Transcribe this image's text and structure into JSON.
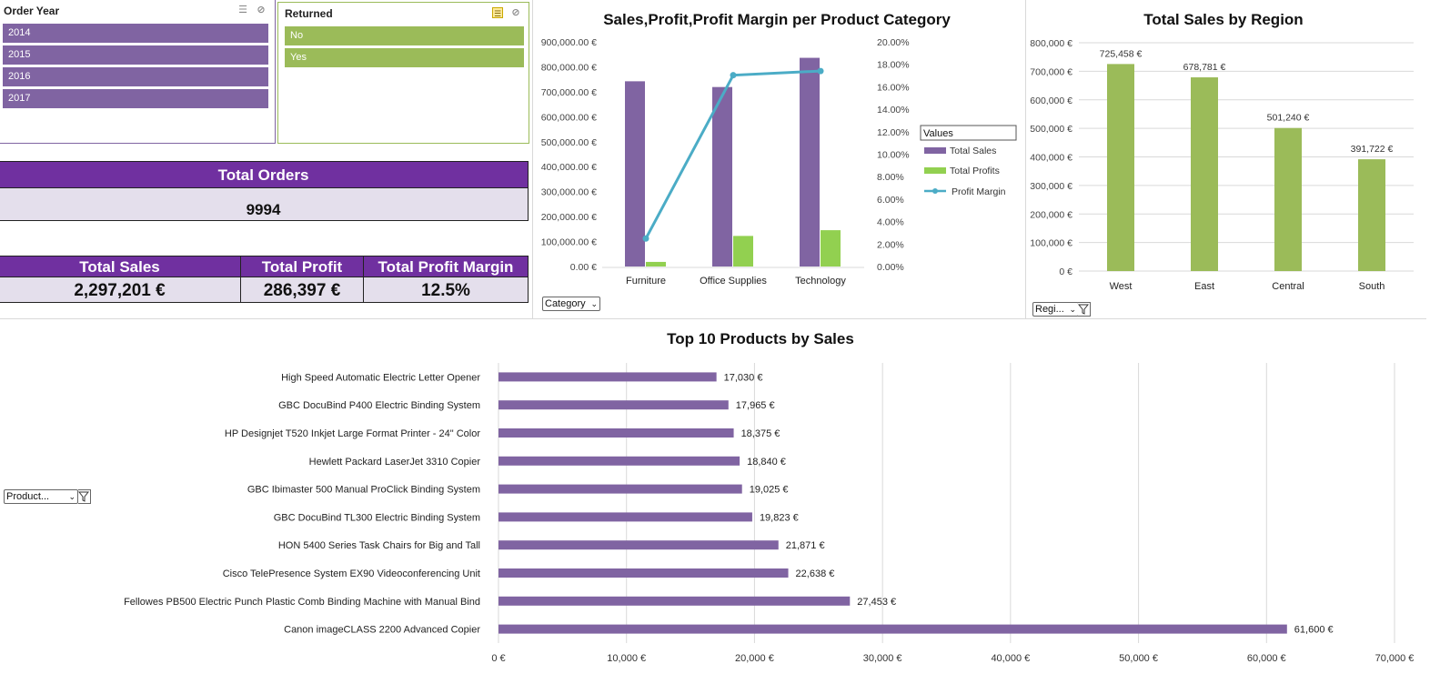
{
  "slicers": {
    "order_year": {
      "title": "Order Year",
      "items": [
        "2014",
        "2015",
        "2016",
        "2017"
      ]
    },
    "returned": {
      "title": "Returned",
      "items": [
        "No",
        "Yes"
      ]
    }
  },
  "kpis": {
    "orders": {
      "label": "Total Orders",
      "value": "9994"
    },
    "sales": {
      "label": "Total  Sales",
      "value": "2,297,201 €"
    },
    "profit": {
      "label": "Total Profit",
      "value": "286,397 €"
    },
    "margin": {
      "label": "Total Profit Margin",
      "value": "12.5%"
    }
  },
  "filters": {
    "category": "Category",
    "region": "Regi...",
    "product": "Product..."
  },
  "colors": {
    "purple": "#8064a2",
    "green_region": "#9bbb59",
    "green_profit": "#92d050",
    "line": "#4bacc6",
    "kpi_head": "#7030a0",
    "kpi_val": "#e4dfec"
  },
  "chart_data": [
    {
      "type": "bar",
      "title": "Sales,Profit,Profit Margin per Product Category",
      "categories": [
        "Furniture",
        "Office Supplies",
        "Technology"
      ],
      "legend_title": "Values",
      "series": [
        {
          "name": "Total Sales",
          "values": [
            742000,
            719000,
            836000
          ],
          "axis": "left"
        },
        {
          "name": "Total Profits",
          "values": [
            18451,
            122491,
            145455
          ],
          "axis": "left"
        },
        {
          "name": "Profit Margin",
          "type": "line",
          "values": [
            0.0249,
            0.1703,
            0.174
          ],
          "axis": "right"
        }
      ],
      "y_left_ticks": [
        "900,000.00 €",
        "800,000.00 €",
        "700,000.00 €",
        "600,000.00 €",
        "500,000.00 €",
        "400,000.00 €",
        "300,000.00 €",
        "200,000.00 €",
        "100,000.00 €",
        "0.00 €"
      ],
      "y_right_ticks": [
        "20.00%",
        "18.00%",
        "16.00%",
        "14.00%",
        "12.00%",
        "10.00%",
        "8.00%",
        "6.00%",
        "4.00%",
        "2.00%",
        "0.00%"
      ],
      "ylim_left": [
        0,
        900000
      ],
      "ylim_right": [
        0,
        0.2
      ],
      "legend_position": "right"
    },
    {
      "type": "bar",
      "title": "Total Sales by Region",
      "categories": [
        "West",
        "East",
        "Central",
        "South"
      ],
      "values": [
        725458,
        678781,
        501240,
        391722
      ],
      "data_labels": [
        "725,458 €",
        "678,781 €",
        "501,240 €",
        "391,722 €"
      ],
      "y_ticks": [
        "800,000 €",
        "700,000 €",
        "600,000 €",
        "500,000 €",
        "400,000 €",
        "300,000 €",
        "200,000 €",
        "100,000 €",
        "0 €"
      ],
      "ylim": [
        0,
        800000
      ],
      "grid": true
    },
    {
      "type": "bar",
      "orientation": "horizontal",
      "title": "Top 10 Products by  Sales",
      "categories": [
        "High Speed Automatic Electric Letter Opener",
        "GBC DocuBind P400 Electric Binding System",
        "HP Designjet T520 Inkjet Large Format Printer - 24\" Color",
        "Hewlett Packard LaserJet 3310 Copier",
        "GBC Ibimaster 500 Manual ProClick Binding System",
        "GBC DocuBind TL300 Electric Binding System",
        "HON 5400 Series Task Chairs for Big and Tall",
        "Cisco TelePresence System EX90 Videoconferencing Unit",
        "Fellowes PB500 Electric Punch Plastic Comb Binding Machine with Manual Bind",
        "Canon imageCLASS 2200 Advanced Copier"
      ],
      "values": [
        17030,
        17965,
        18375,
        18840,
        19025,
        19823,
        21871,
        22638,
        27453,
        61600
      ],
      "data_labels": [
        "17,030 €",
        "17,965 €",
        "18,375 €",
        "18,840 €",
        "19,025 €",
        "19,823 €",
        "21,871 €",
        "22,638 €",
        "27,453 €",
        "61,600 €"
      ],
      "x_ticks": [
        "0 €",
        "10,000 €",
        "20,000 €",
        "30,000 €",
        "40,000 €",
        "50,000 €",
        "60,000 €",
        "70,000 €"
      ],
      "xlim": [
        0,
        70000
      ],
      "grid": true
    }
  ]
}
